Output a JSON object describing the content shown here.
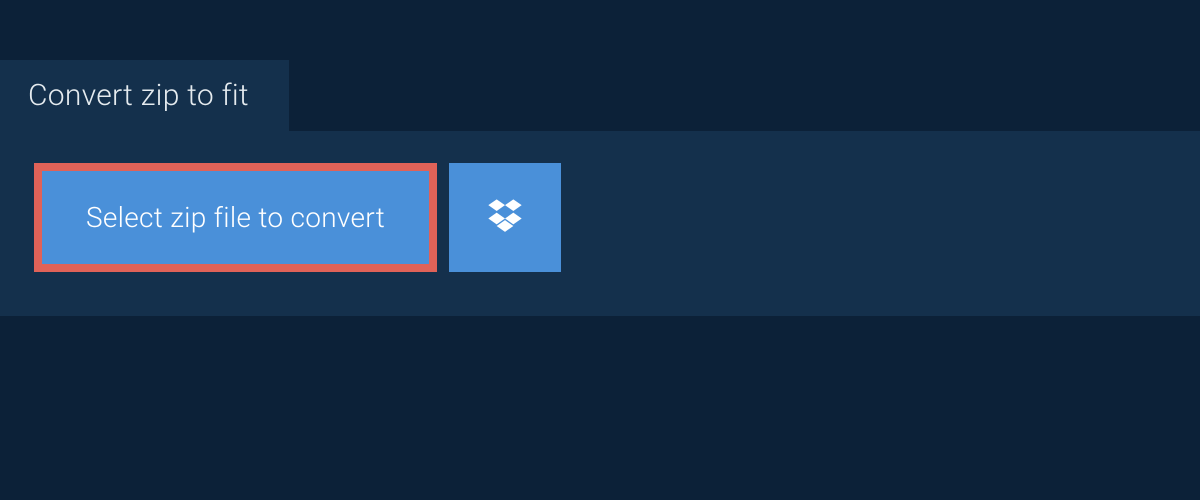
{
  "tab": {
    "title": "Convert zip to fit"
  },
  "actions": {
    "select_label": "Select zip file to convert"
  },
  "colors": {
    "background": "#0c2138",
    "panel": "#14304c",
    "button": "#4a90d9",
    "highlight_border": "#e06258",
    "text": "#ffffff"
  }
}
